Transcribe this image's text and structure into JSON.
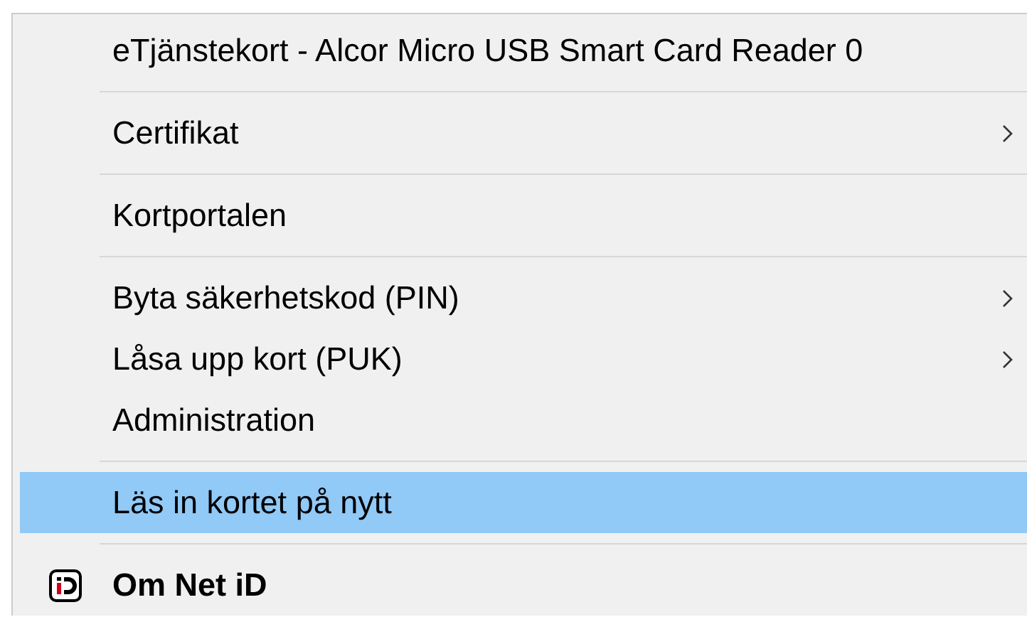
{
  "menu": {
    "items": [
      {
        "kind": "item",
        "label": "eTjänstekort - Alcor Micro USB Smart Card Reader 0",
        "submenu": false,
        "selected": false,
        "default": false,
        "has_icon": false
      },
      {
        "kind": "separator"
      },
      {
        "kind": "item",
        "label": "Certifikat",
        "submenu": true,
        "selected": false,
        "default": false,
        "has_icon": false
      },
      {
        "kind": "separator"
      },
      {
        "kind": "item",
        "label": "Kortportalen",
        "submenu": false,
        "selected": false,
        "default": false,
        "has_icon": false
      },
      {
        "kind": "separator"
      },
      {
        "kind": "item",
        "label": "Byta säkerhetskod (PIN)",
        "submenu": true,
        "selected": false,
        "default": false,
        "has_icon": false
      },
      {
        "kind": "item",
        "label": "Låsa upp kort (PUK)",
        "submenu": true,
        "selected": false,
        "default": false,
        "has_icon": false
      },
      {
        "kind": "item",
        "label": "Administration",
        "submenu": false,
        "selected": false,
        "default": false,
        "has_icon": false
      },
      {
        "kind": "separator"
      },
      {
        "kind": "item",
        "label": "Läs in kortet på nytt",
        "submenu": false,
        "selected": true,
        "default": false,
        "has_icon": false
      },
      {
        "kind": "separator"
      },
      {
        "kind": "item",
        "label": "Om Net iD",
        "submenu": false,
        "selected": false,
        "default": true,
        "has_icon": true
      }
    ]
  }
}
